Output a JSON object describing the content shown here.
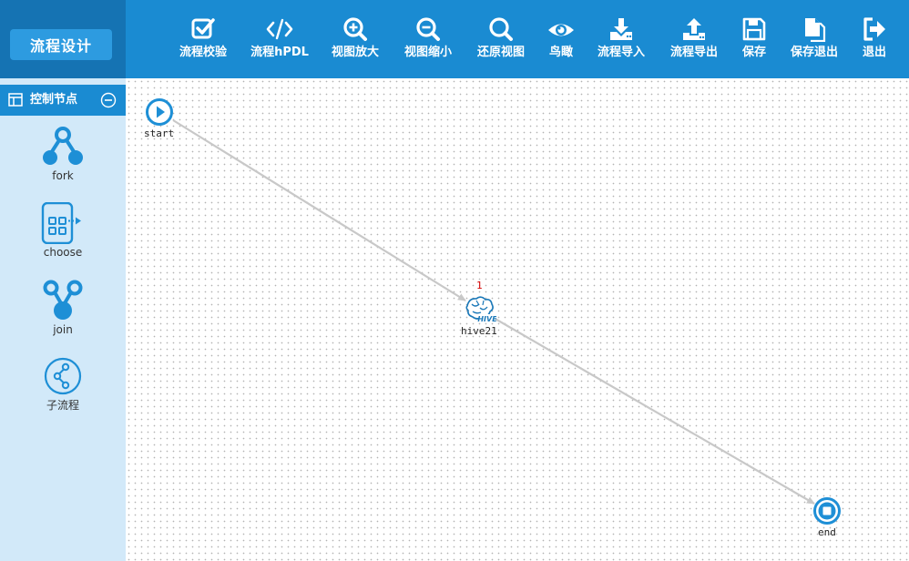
{
  "app": {
    "brand": "流程设计"
  },
  "toolbar": {
    "validate": "流程校验",
    "hpdl": "流程hPDL",
    "zoom_in": "视图放大",
    "zoom_out": "视图缩小",
    "reset_view": "还原视图",
    "birds_eye": "鸟瞰",
    "import": "流程导入",
    "export": "流程导出",
    "save": "保存",
    "save_exit": "保存退出",
    "exit": "退出"
  },
  "sidebar": {
    "title": "控制节点",
    "items": [
      {
        "label": "fork",
        "icon": "fork-icon"
      },
      {
        "label": "choose",
        "icon": "choose-icon"
      },
      {
        "label": "join",
        "icon": "join-icon"
      },
      {
        "label": "子流程",
        "icon": "subflow-icon"
      }
    ]
  },
  "canvas": {
    "nodes": {
      "start": {
        "label": "start",
        "icon": "play-icon"
      },
      "hive": {
        "label": "hive21",
        "seq": "1",
        "icon": "hive-icon"
      },
      "end": {
        "label": "end",
        "icon": "stop-icon"
      }
    },
    "edges": [
      {
        "from": "start",
        "to": "hive21"
      },
      {
        "from": "hive21",
        "to": "end"
      }
    ]
  },
  "colors": {
    "toolbar_bg": "#1a8bd2",
    "brand_bg": "#1573b3",
    "sidebar_bg": "#d2e9f9",
    "node_blue": "#1e8fd6",
    "edge": "#c8c8c8",
    "seq_red": "#d40000"
  }
}
